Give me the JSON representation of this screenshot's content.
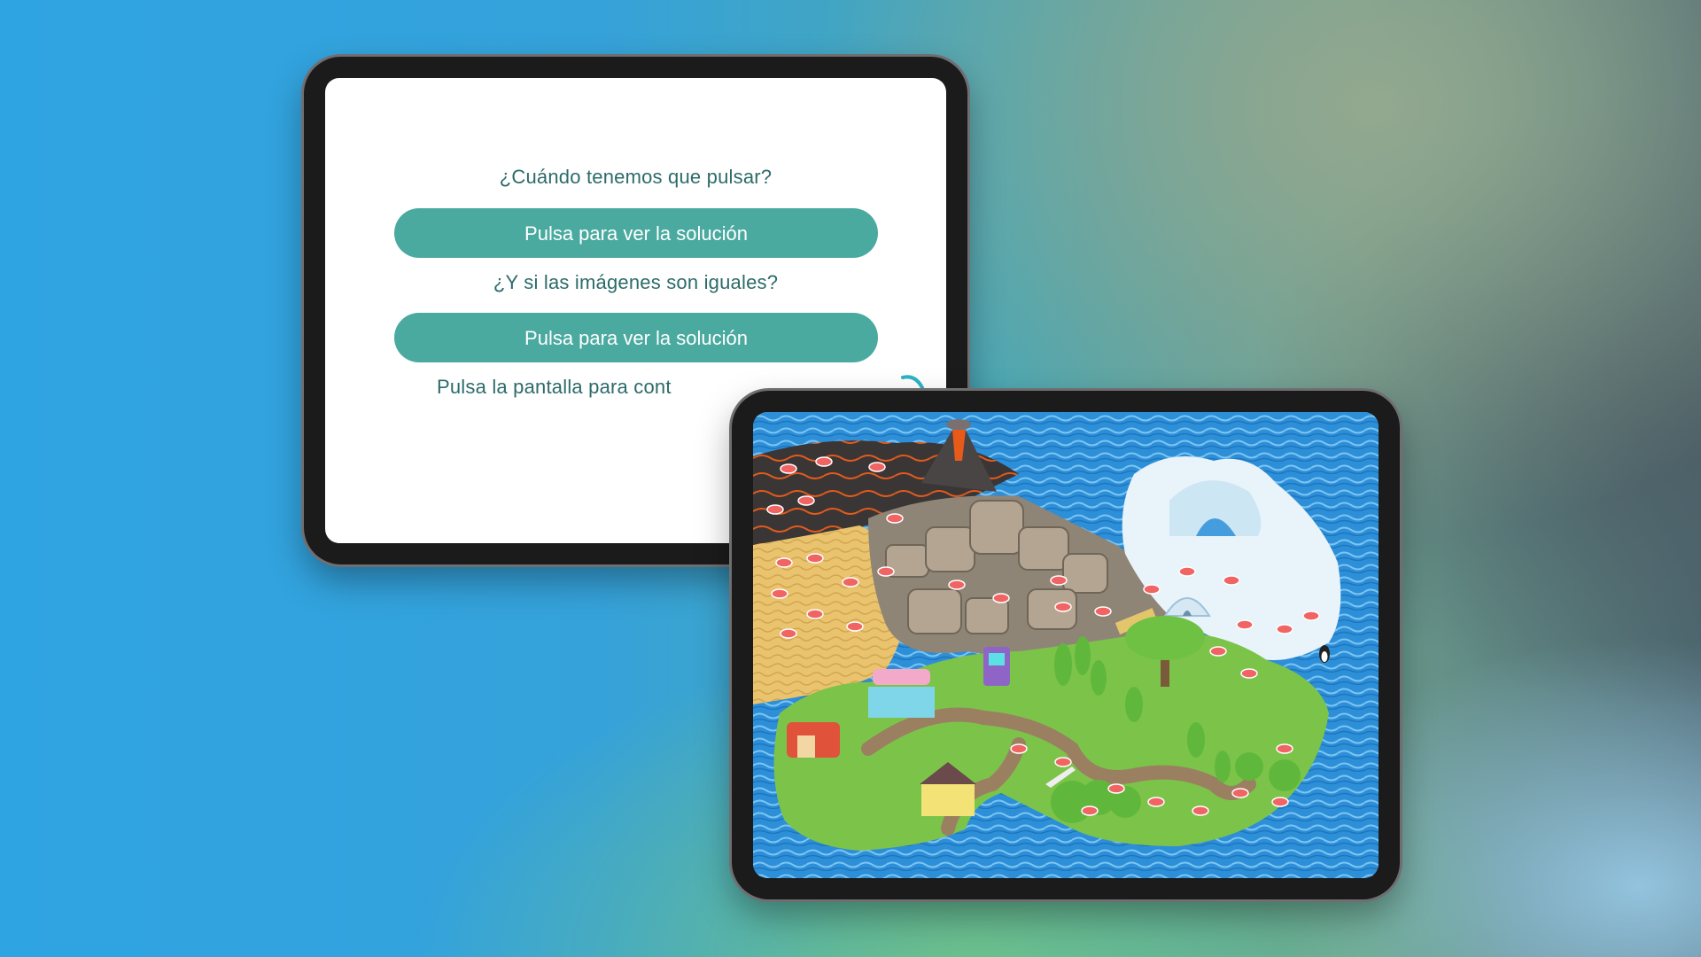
{
  "instructions_screen": {
    "question_1": "¿Cuándo tenemos que pulsar?",
    "button_1_label": "Pulsa para ver la solución",
    "question_2": "¿Y si las imágenes son iguales?",
    "button_2_label": "Pulsa para ver la solución",
    "continue_hint": "Pulsa la pantalla para cont"
  },
  "colors": {
    "button_teal": "#4aaaa0",
    "text_teal": "#2c6b6a",
    "water_blue": "#2b8fd6",
    "land_green": "#7cc34a"
  },
  "game_map": {
    "zones": [
      "volcano",
      "desert",
      "rocks",
      "ice",
      "town"
    ],
    "icons": [
      "volcano-icon",
      "igloo-icon",
      "tree-icon",
      "arcade-icon",
      "barn-icon",
      "dumbbell-sign-icon",
      "house-icon",
      "penguin-icon",
      "airplane-icon"
    ]
  }
}
